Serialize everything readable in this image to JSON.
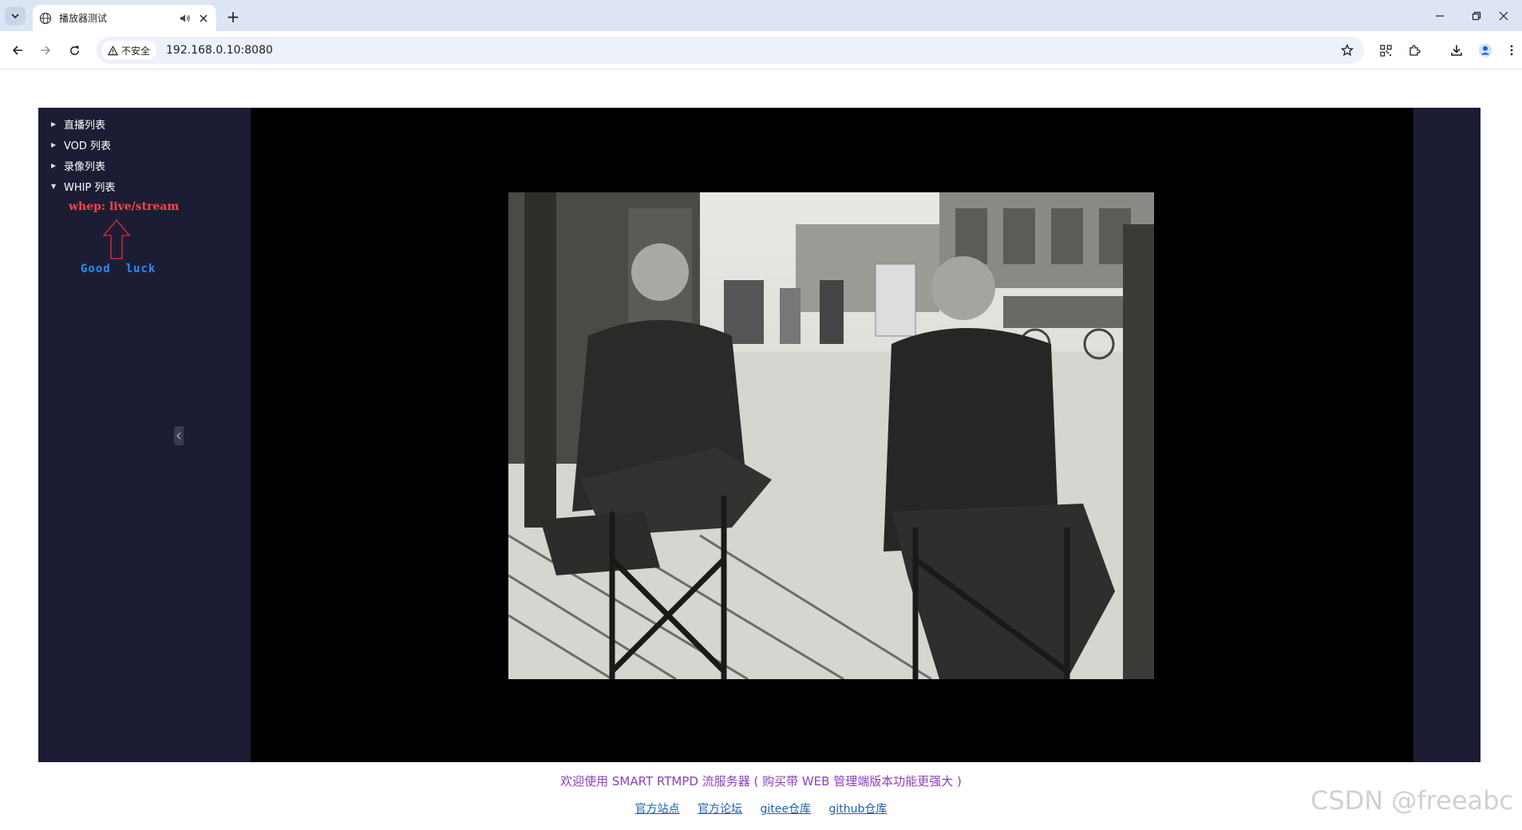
{
  "browser": {
    "tab_title": "播放器测试",
    "new_tab_glyph": "+",
    "security_label": "不安全",
    "url": "192.168.0.10:8080",
    "icons": [
      "tab-search-icon",
      "globe-icon",
      "audio-icon",
      "close-icon",
      "back-icon",
      "forward-icon",
      "reload-icon",
      "warning-icon",
      "star-icon",
      "qr-icon",
      "extensions-icon",
      "download-icon",
      "profile-icon",
      "menu-icon",
      "minimize-icon",
      "restore-icon",
      "window-close-icon"
    ]
  },
  "sidebar": {
    "items": [
      {
        "label": "直播列表",
        "expanded": false
      },
      {
        "label": "VOD 列表",
        "expanded": false
      },
      {
        "label": "录像列表",
        "expanded": false
      },
      {
        "label": "WHIP 列表",
        "expanded": true
      }
    ],
    "stream": "whep: live/stream",
    "annotation": "Good  luck"
  },
  "footer": {
    "welcome": "欢迎使用 SMART RTMPD 流服务器 ( 购买带 WEB 管理端版本功能更强大 )",
    "links": [
      "官方站点",
      "官方论坛",
      "gitee仓库",
      "github仓库"
    ]
  },
  "watermark": "CSDN @freeabc",
  "colors": {
    "sidebar_bg": "#1c1d35",
    "player_bg": "#000000",
    "stream_link": "#ff4444",
    "annotation": "#1e90ff",
    "welcome_text": "#8a3fb8",
    "link": "#1a5fb4"
  }
}
